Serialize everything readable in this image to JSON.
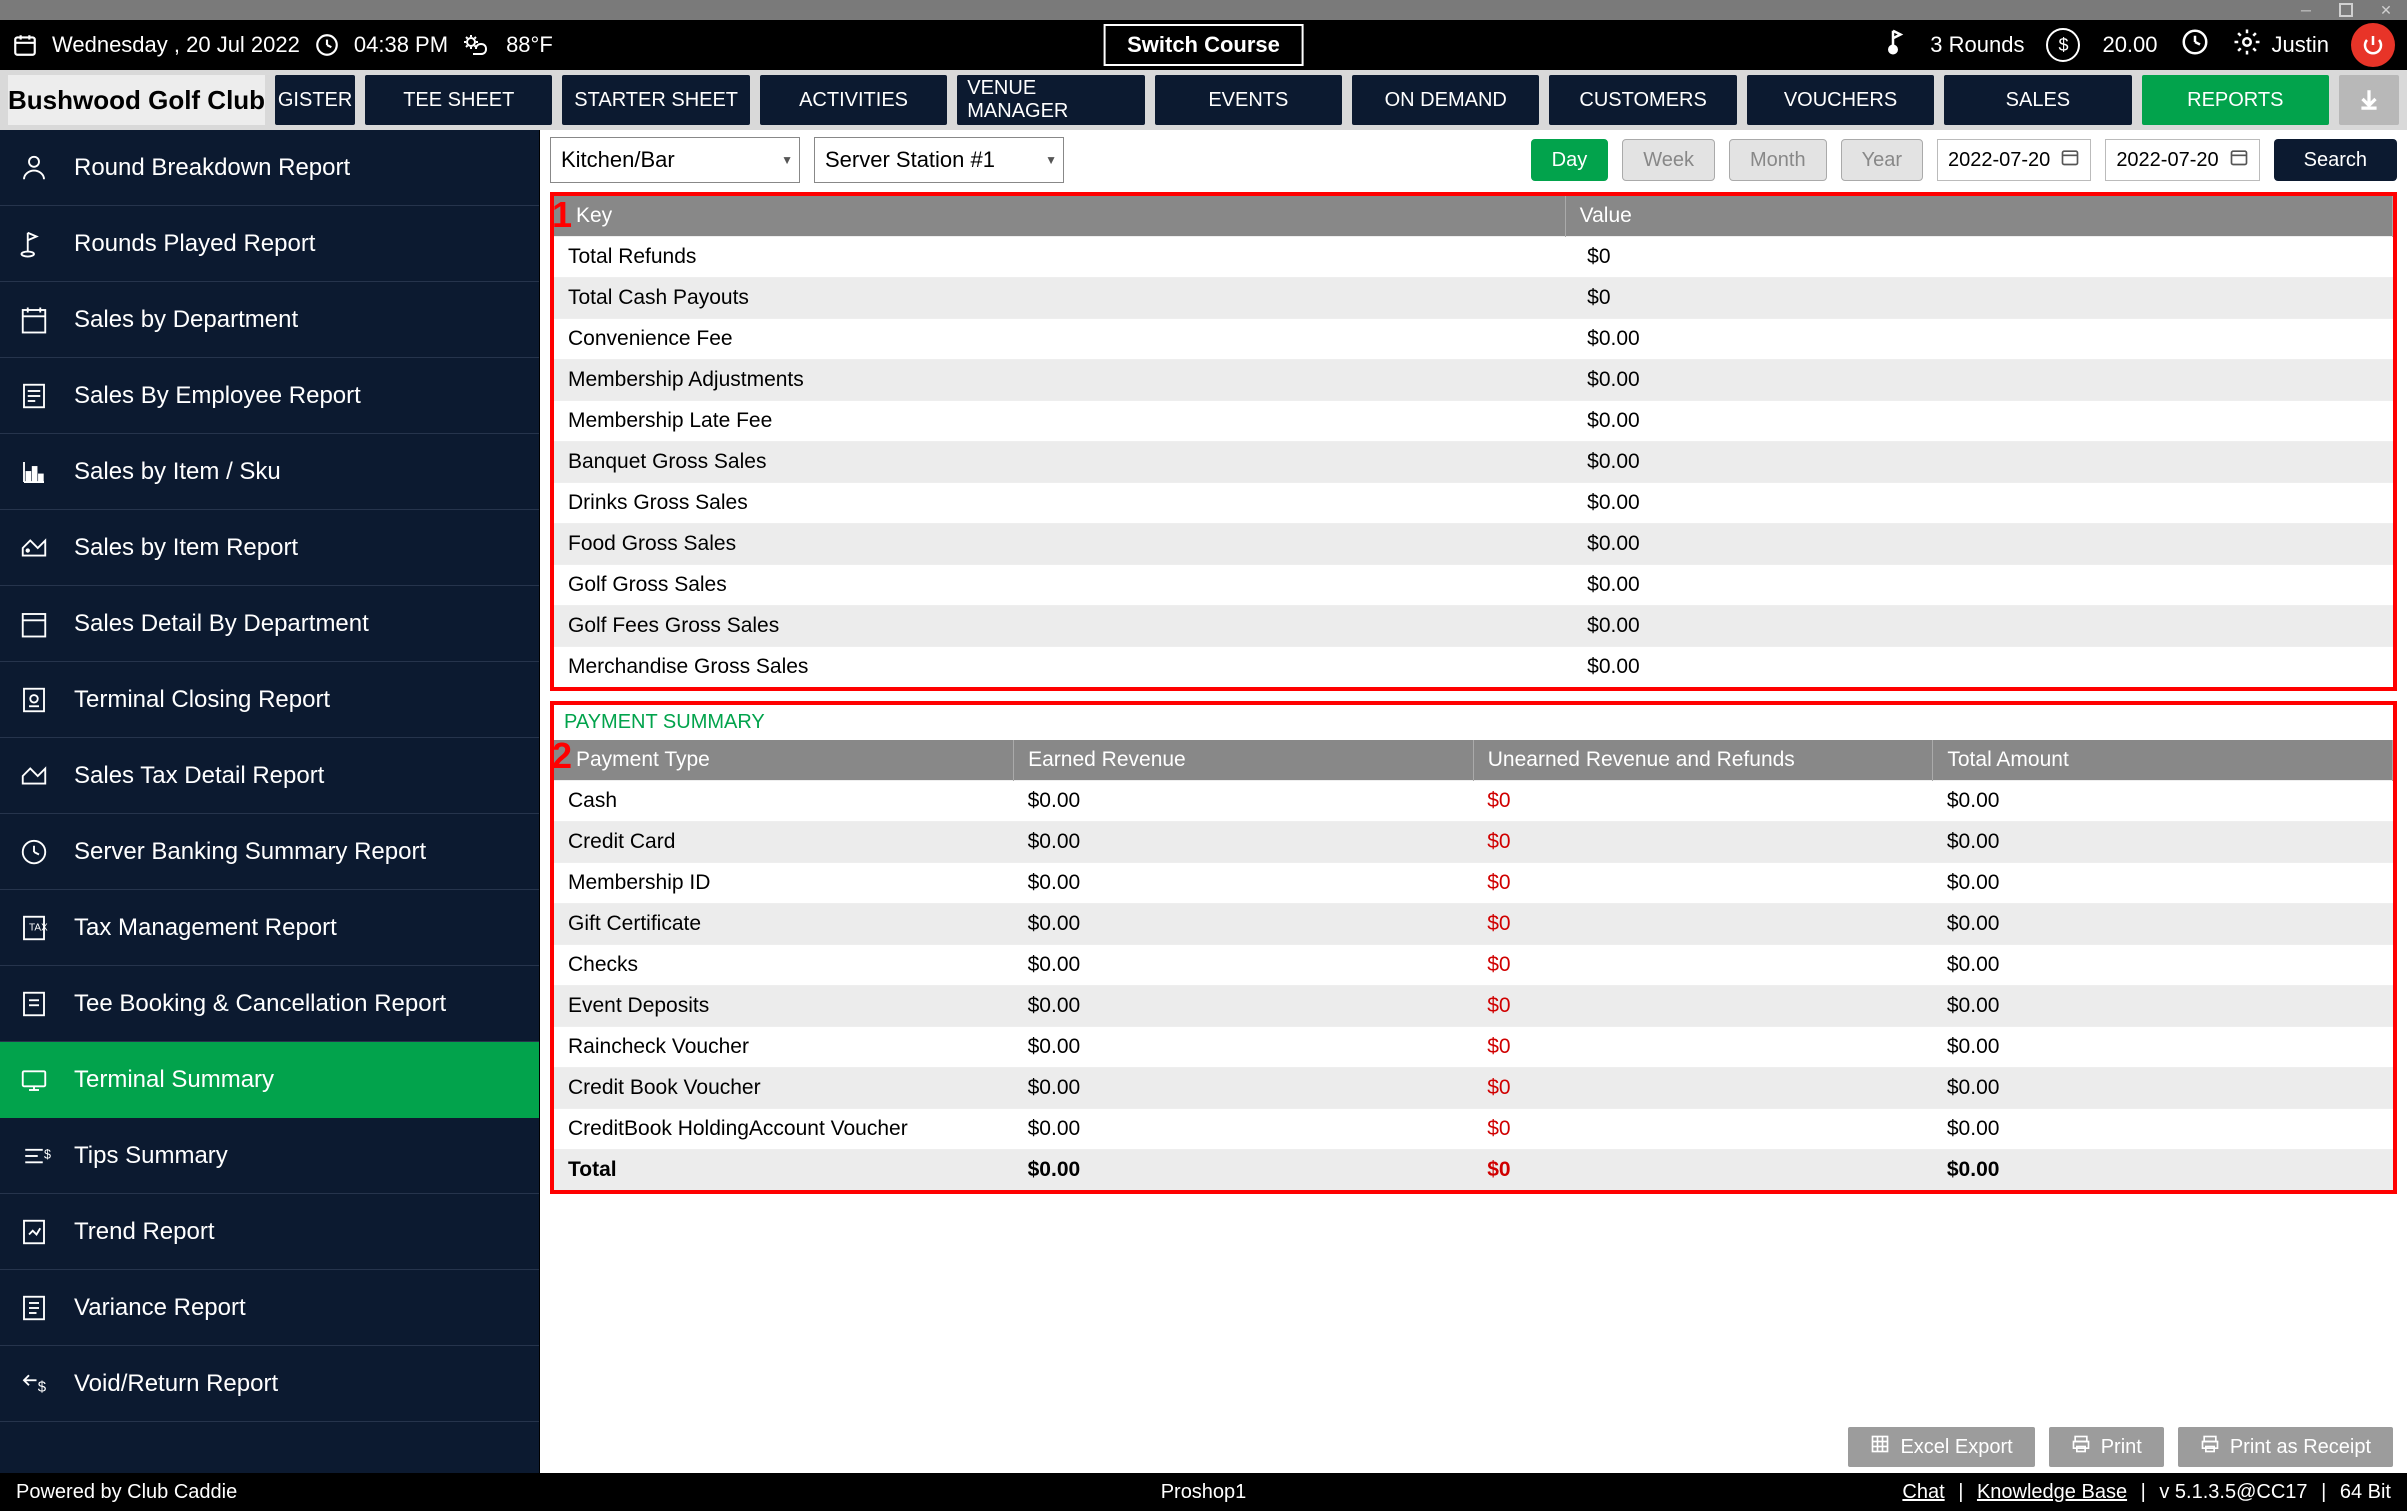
{
  "topbar": {
    "date": "Wednesday ,  20 Jul 2022",
    "time": "04:38 PM",
    "temp": "88°F",
    "switch": "Switch Course",
    "rounds": "3 Rounds",
    "balance": "20.00",
    "user": "Justin"
  },
  "brand": "Bushwood Golf Club",
  "nav_cut": "GISTER",
  "nav": [
    "TEE SHEET",
    "STARTER SHEET",
    "ACTIVITIES",
    "VENUE MANAGER",
    "EVENTS",
    "ON DEMAND",
    "CUSTOMERS",
    "VOUCHERS",
    "SALES",
    "REPORTS"
  ],
  "nav_active": 9,
  "sidebar": [
    "Round Breakdown Report",
    "Rounds Played Report",
    "Sales by Department",
    "Sales By Employee Report",
    "Sales by Item / Sku",
    "Sales by Item Report",
    "Sales Detail By Department",
    "Terminal Closing Report",
    "Sales Tax Detail Report",
    "Server Banking Summary Report",
    "Tax Management Report",
    "Tee Booking & Cancellation Report",
    "Terminal Summary",
    "Tips Summary",
    "Trend Report",
    "Variance Report",
    "Void/Return Report"
  ],
  "sidebar_active": 12,
  "filters": {
    "dd1": "Kitchen/Bar",
    "dd2": "Server Station #1",
    "range": {
      "day": "Day",
      "week": "Week",
      "month": "Month",
      "year": "Year"
    },
    "date1": "2022-07-20",
    "date2": "2022-07-20",
    "search": "Search"
  },
  "table1": {
    "headers": [
      "Key",
      "Value"
    ],
    "rows": [
      [
        "Total Refunds",
        "$0"
      ],
      [
        "Total Cash Payouts",
        "$0"
      ],
      [
        "Convenience Fee",
        "$0.00"
      ],
      [
        "Membership Adjustments",
        "$0.00"
      ],
      [
        "Membership Late Fee",
        "$0.00"
      ],
      [
        "Banquet Gross Sales",
        "$0.00"
      ],
      [
        "Drinks Gross Sales",
        "$0.00"
      ],
      [
        "Food Gross Sales",
        "$0.00"
      ],
      [
        "Golf Gross Sales",
        "$0.00"
      ],
      [
        "Golf Fees Gross Sales",
        "$0.00"
      ],
      [
        "Merchandise Gross Sales",
        "$0.00"
      ]
    ]
  },
  "section2_title": "PAYMENT SUMMARY",
  "table2": {
    "headers": [
      "Payment Type",
      "Earned Revenue",
      "Unearned Revenue and Refunds",
      "Total Amount"
    ],
    "rows": [
      [
        "Cash",
        "$0.00",
        "$0",
        "$0.00"
      ],
      [
        "Credit Card",
        "$0.00",
        "$0",
        "$0.00"
      ],
      [
        "Membership ID",
        "$0.00",
        "$0",
        "$0.00"
      ],
      [
        "Gift Certificate",
        "$0.00",
        "$0",
        "$0.00"
      ],
      [
        "Checks",
        "$0.00",
        "$0",
        "$0.00"
      ],
      [
        "Event Deposits",
        "$0.00",
        "$0",
        "$0.00"
      ],
      [
        "Raincheck Voucher",
        "$0.00",
        "$0",
        "$0.00"
      ],
      [
        "Credit Book Voucher",
        "$0.00",
        "$0",
        "$0.00"
      ],
      [
        "CreditBook HoldingAccount Voucher",
        "$0.00",
        "$0",
        "$0.00"
      ]
    ],
    "total": [
      "Total",
      "$0.00",
      "$0",
      "$0.00"
    ]
  },
  "bottom": {
    "excel": "Excel Export",
    "print": "Print",
    "receipt": "Print as Receipt"
  },
  "footer": {
    "left": "Powered by Club Caddie",
    "center": "Proshop1",
    "chat": "Chat",
    "kb": "Knowledge Base",
    "ver": "v 5.1.3.5@CC17",
    "bit": "64 Bit"
  }
}
